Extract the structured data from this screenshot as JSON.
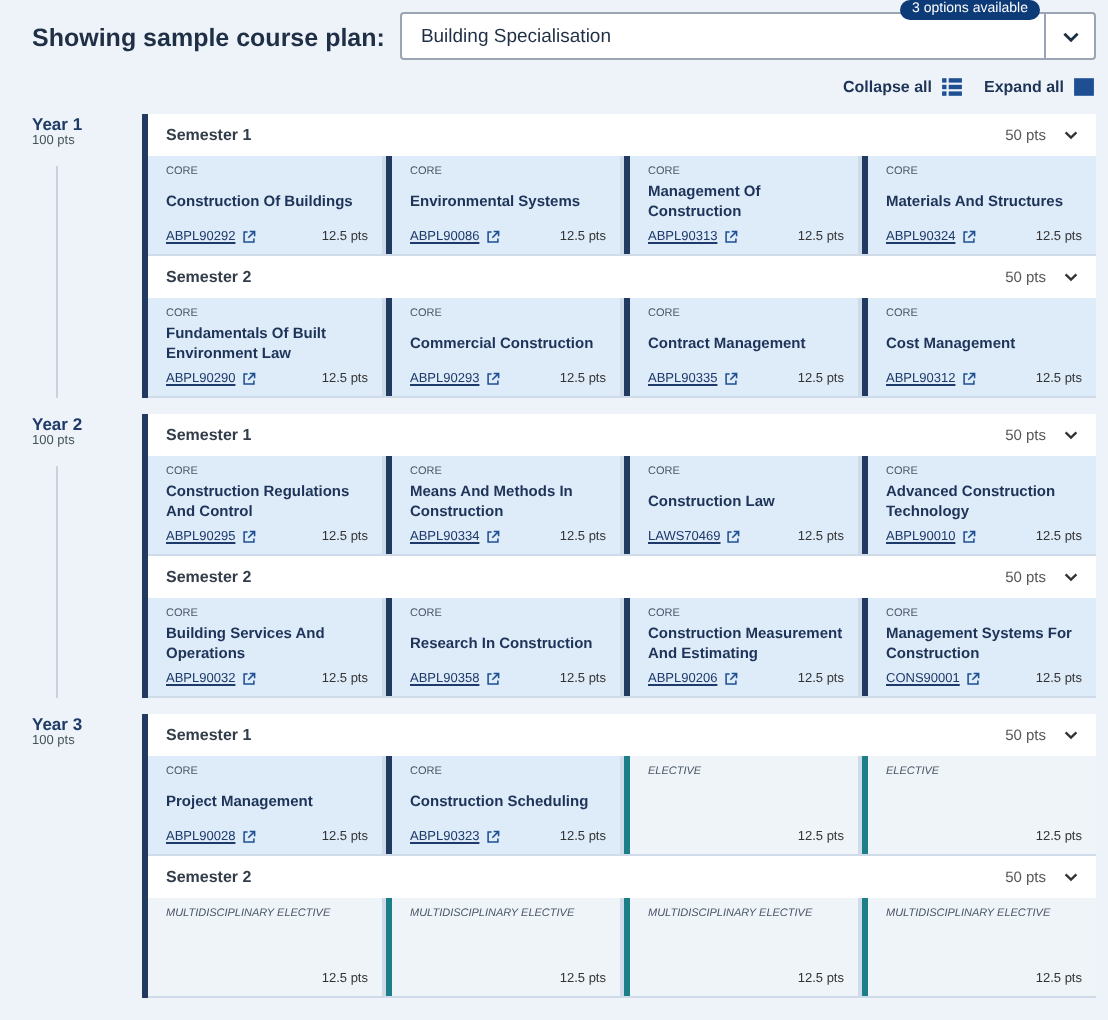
{
  "plan_selector": {
    "label": "Showing sample course plan:",
    "value": "Building Specialisation",
    "badge": "3 options available"
  },
  "controls": {
    "collapse": "Collapse all",
    "expand": "Expand all"
  },
  "years": [
    {
      "label": "Year 1",
      "points": "100 pts",
      "semesters": [
        {
          "label": "Semester 1",
          "points": "50 pts",
          "expanded": true,
          "courses": [
            {
              "kind": "core",
              "type": "CORE",
              "title": "Construction Of Buildings",
              "code": "ABPL90292",
              "points": "12.5 pts"
            },
            {
              "kind": "core",
              "type": "CORE",
              "title": "Environmental Systems",
              "code": "ABPL90086",
              "points": "12.5 pts"
            },
            {
              "kind": "core",
              "type": "CORE",
              "title": "Management Of Construction",
              "code": "ABPL90313",
              "points": "12.5 pts"
            },
            {
              "kind": "core",
              "type": "CORE",
              "title": "Materials And Structures",
              "code": "ABPL90324",
              "points": "12.5 pts"
            }
          ]
        },
        {
          "label": "Semester 2",
          "points": "50 pts",
          "expanded": true,
          "courses": [
            {
              "kind": "core",
              "type": "CORE",
              "title": "Fundamentals Of Built Environment Law",
              "code": "ABPL90290",
              "points": "12.5 pts"
            },
            {
              "kind": "core",
              "type": "CORE",
              "title": "Commercial Construction",
              "code": "ABPL90293",
              "points": "12.5 pts"
            },
            {
              "kind": "core",
              "type": "CORE",
              "title": "Contract Management",
              "code": "ABPL90335",
              "points": "12.5 pts"
            },
            {
              "kind": "core",
              "type": "CORE",
              "title": "Cost Management",
              "code": "ABPL90312",
              "points": "12.5 pts"
            }
          ]
        }
      ]
    },
    {
      "label": "Year 2",
      "points": "100 pts",
      "semesters": [
        {
          "label": "Semester 1",
          "points": "50 pts",
          "expanded": true,
          "courses": [
            {
              "kind": "core",
              "type": "CORE",
              "title": "Construction Regulations And Control",
              "code": "ABPL90295",
              "points": "12.5 pts"
            },
            {
              "kind": "core",
              "type": "CORE",
              "title": "Means And Methods In Construction",
              "code": "ABPL90334",
              "points": "12.5 pts"
            },
            {
              "kind": "core",
              "type": "CORE",
              "title": "Construction Law",
              "code": "LAWS70469",
              "points": "12.5 pts"
            },
            {
              "kind": "core",
              "type": "CORE",
              "title": "Advanced Construction Technology",
              "code": "ABPL90010",
              "points": "12.5 pts"
            }
          ]
        },
        {
          "label": "Semester 2",
          "points": "50 pts",
          "expanded": true,
          "courses": [
            {
              "kind": "core",
              "type": "CORE",
              "title": "Building Services And Operations",
              "code": "ABPL90032",
              "points": "12.5 pts"
            },
            {
              "kind": "core",
              "type": "CORE",
              "title": "Research In Construction",
              "code": "ABPL90358",
              "points": "12.5 pts"
            },
            {
              "kind": "core",
              "type": "CORE",
              "title": "Construction Measurement And Estimating",
              "code": "ABPL90206",
              "points": "12.5 pts"
            },
            {
              "kind": "core",
              "type": "CORE",
              "title": "Management Systems For Construction",
              "code": "CONS90001",
              "points": "12.5 pts"
            }
          ]
        }
      ]
    },
    {
      "label": "Year 3",
      "points": "100 pts",
      "semesters": [
        {
          "label": "Semester 1",
          "points": "50 pts",
          "expanded": true,
          "courses": [
            {
              "kind": "core",
              "type": "CORE",
              "title": "Project Management",
              "code": "ABPL90028",
              "points": "12.5 pts"
            },
            {
              "kind": "core",
              "type": "CORE",
              "title": "Construction Scheduling",
              "code": "ABPL90323",
              "points": "12.5 pts"
            },
            {
              "kind": "elective",
              "type": "ELECTIVE",
              "points": "12.5 pts"
            },
            {
              "kind": "elective",
              "type": "ELECTIVE",
              "points": "12.5 pts"
            }
          ]
        },
        {
          "label": "Semester 2",
          "points": "50 pts",
          "expanded": true,
          "courses": [
            {
              "kind": "elective",
              "type": "MULTIDISCIPLINARY ELECTIVE",
              "points": "12.5 pts"
            },
            {
              "kind": "elective",
              "type": "MULTIDISCIPLINARY ELECTIVE",
              "points": "12.5 pts"
            },
            {
              "kind": "elective",
              "type": "MULTIDISCIPLINARY ELECTIVE",
              "points": "12.5 pts"
            },
            {
              "kind": "elective",
              "type": "MULTIDISCIPLINARY ELECTIVE",
              "points": "12.5 pts"
            }
          ]
        }
      ]
    }
  ]
}
